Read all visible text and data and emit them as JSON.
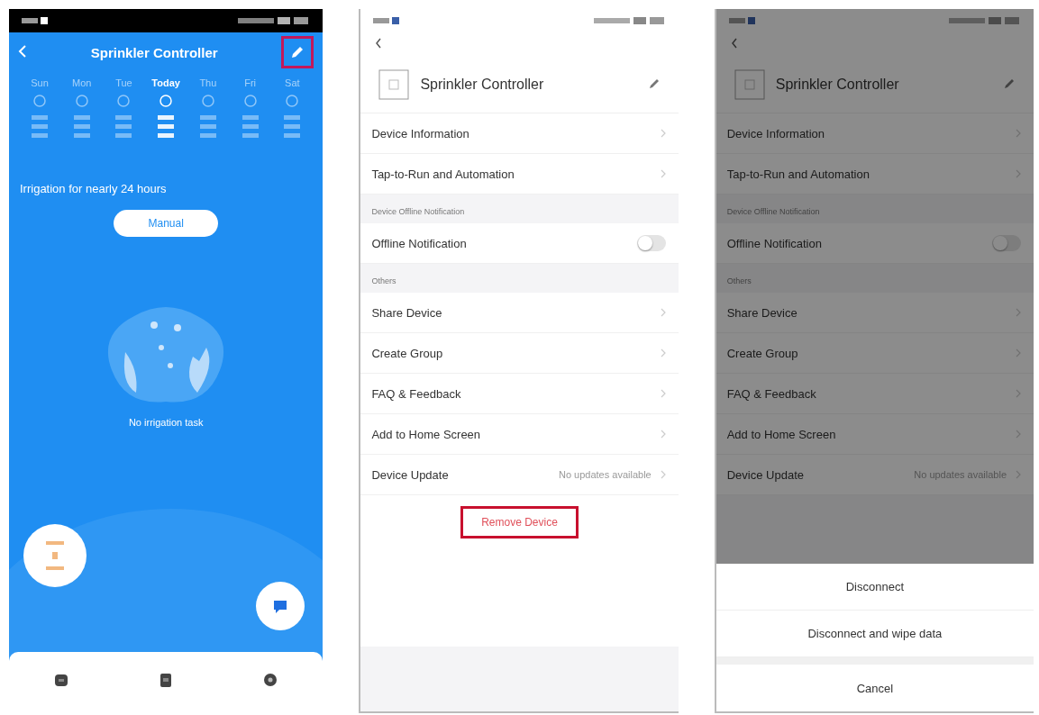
{
  "screens": [
    {
      "kind": "controller",
      "title": "Sprinkler Controller",
      "edit_highlighted": true,
      "days": [
        {
          "label": "Sun",
          "selected": false
        },
        {
          "label": "Mon",
          "selected": false
        },
        {
          "label": "Tue",
          "selected": false
        },
        {
          "label": "Today",
          "selected": true
        },
        {
          "label": "Thu",
          "selected": false
        },
        {
          "label": "Fri",
          "selected": false
        },
        {
          "label": "Sat",
          "selected": false
        }
      ],
      "irrigation_status": "Irrigation for nearly 24 hours",
      "mode_button": "Manual",
      "empty_message": "No irrigation task"
    },
    {
      "kind": "settings",
      "dimmed": false,
      "device_name": "Sprinkler Controller",
      "sections": [
        {
          "items": [
            {
              "kind": "link",
              "label": "Device Information"
            },
            {
              "kind": "link",
              "label": "Tap-to-Run and Automation"
            }
          ]
        },
        {
          "header": "Device Offline Notification",
          "items": [
            {
              "kind": "toggle",
              "label": "Offline Notification",
              "on": false
            }
          ]
        },
        {
          "header": "Others",
          "items": [
            {
              "kind": "link",
              "label": "Share Device"
            },
            {
              "kind": "link",
              "label": "Create Group"
            },
            {
              "kind": "link",
              "label": "FAQ & Feedback"
            },
            {
              "kind": "link",
              "label": "Add to Home Screen"
            },
            {
              "kind": "link",
              "label": "Device Update",
              "value": "No updates available"
            }
          ]
        }
      ],
      "remove_button": {
        "label": "Remove Device",
        "highlighted": true
      }
    },
    {
      "kind": "settings",
      "dimmed": true,
      "device_name": "Sprinkler Controller",
      "sections": [
        {
          "items": [
            {
              "kind": "link",
              "label": "Device Information"
            },
            {
              "kind": "link",
              "label": "Tap-to-Run and Automation"
            }
          ]
        },
        {
          "header": "Device Offline Notification",
          "items": [
            {
              "kind": "toggle",
              "label": "Offline Notification",
              "on": false
            }
          ]
        },
        {
          "header": "Others",
          "items": [
            {
              "kind": "link",
              "label": "Share Device"
            },
            {
              "kind": "link",
              "label": "Create Group"
            },
            {
              "kind": "link",
              "label": "FAQ & Feedback"
            },
            {
              "kind": "link",
              "label": "Add to Home Screen"
            },
            {
              "kind": "link",
              "label": "Device Update",
              "value": "No updates available"
            }
          ]
        }
      ],
      "action_sheet": {
        "options": [
          "Disconnect",
          "Disconnect and wipe data"
        ],
        "cancel": "Cancel"
      }
    }
  ]
}
